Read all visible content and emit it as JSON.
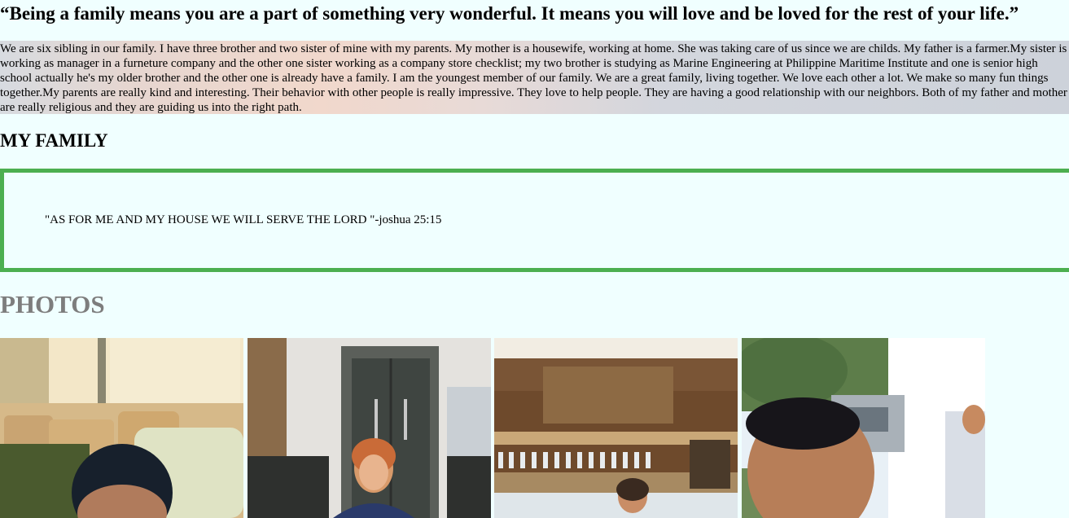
{
  "quote": "“Being a family means you are a part of something very wonderful. It means you will love and be loved for the rest of your life.”",
  "intro": "We are six sibling in our family. I have three brother and two sister of mine with my parents. My mother is a housewife, working at home. She was taking care of us since we are childs. My father is a farmer.My sister is working as manager in a furneture company and the other one sister working as a company store checklist; my two brother is studying as Marine Engineering at Philippine Maritime Institute and one is senior high school actually he's my older brother and the other one is already have a family. I am the youngest member of our family. We are a great family, living together. We love each other a lot. We make so many fun things together.My parents are really kind and interesting. Their behavior with other people is really impressive. They love to help people. They are having a good relationship with our neighbors. Both of my father and mother are really religious and they are guiding us into the right path.",
  "family_heading": "MY FAMILY",
  "verse": "\"AS FOR ME AND MY HOUSE WE WILL SERVE THE LORD \"-joshua 25:15",
  "photos_heading": "PHOTOS",
  "photos": [
    {
      "name": "photo-bus-selfie"
    },
    {
      "name": "photo-woman-at-door"
    },
    {
      "name": "photo-cafe-bar"
    },
    {
      "name": "photo-outdoor-selfie"
    }
  ],
  "colors": {
    "page_bg": "#f0ffff",
    "verse_border": "#4caf50",
    "photos_heading": "#7d7d7d"
  }
}
